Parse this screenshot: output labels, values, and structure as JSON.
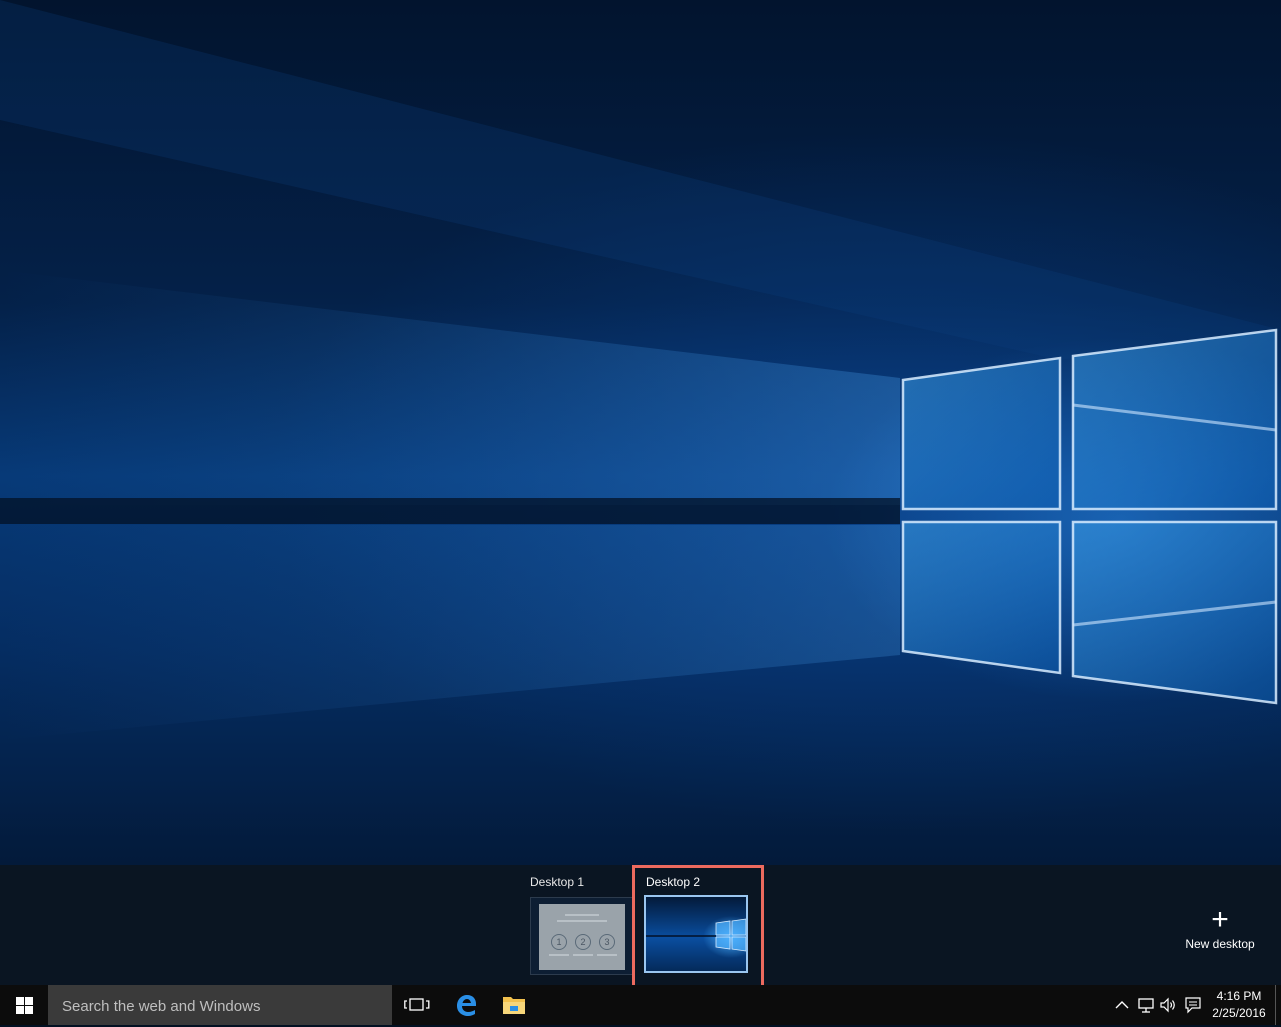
{
  "task_view": {
    "desktops": [
      {
        "label": "Desktop 1",
        "thumbnail_steps": [
          "1",
          "2",
          "3"
        ]
      },
      {
        "label": "Desktop 2",
        "highlighted": true
      }
    ],
    "new_desktop_label": "New desktop",
    "new_desktop_icon": "plus-icon"
  },
  "taskbar": {
    "start_icon": "windows-logo-icon",
    "search_placeholder": "Search the web and Windows",
    "pinned": [
      {
        "name": "task-view",
        "icon": "task-view-icon"
      },
      {
        "name": "edge",
        "icon": "edge-browser-icon"
      },
      {
        "name": "file-explorer",
        "icon": "folder-icon"
      }
    ],
    "tray": {
      "icons": [
        "chevron-up-icon",
        "network-icon",
        "volume-icon",
        "action-center-icon"
      ],
      "time": "4:16 PM",
      "date": "2/25/2016"
    }
  },
  "colors": {
    "highlight_frame": "#ec6a5e",
    "accent": "#0078d7",
    "taskbar": "#0c0c0c",
    "search_bg": "#3a3a3a"
  }
}
